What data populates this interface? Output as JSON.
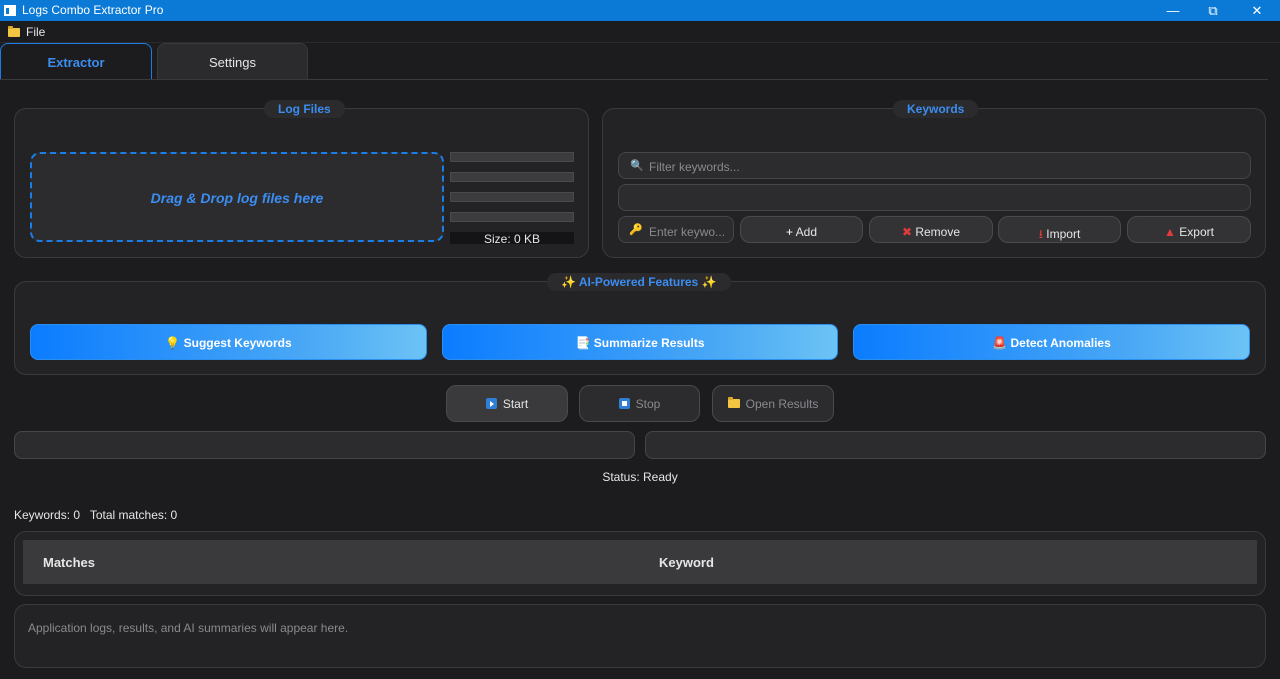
{
  "window": {
    "title": "Logs Combo Extractor Pro"
  },
  "menu": {
    "file": "File"
  },
  "tabs": {
    "extractor": "Extractor",
    "settings": "Settings"
  },
  "log_files": {
    "title": "Log Files",
    "dropzone": "Drag & Drop log files here",
    "size": "Size: 0 KB"
  },
  "keywords_panel": {
    "title": "Keywords",
    "filter_placeholder": "Filter keywords...",
    "enter_placeholder": "Enter keywo...",
    "add": "Add",
    "remove": "Remove",
    "import": "Import",
    "export": "Export"
  },
  "ai": {
    "title": "AI-Powered Features",
    "suggest": "Suggest Keywords",
    "summarize": "Summarize Results",
    "detect": "Detect Anomalies"
  },
  "controls": {
    "start": "Start",
    "stop": "Stop",
    "open_results": "Open Results"
  },
  "status": "Status: Ready",
  "counts": {
    "keywords": "Keywords: 0",
    "matches": "Total matches: 0"
  },
  "table": {
    "columns": [
      "Matches",
      "Keyword"
    ]
  },
  "log": {
    "placeholder": "Application logs, results, and AI summaries will appear here."
  },
  "colors": {
    "accent": "#1a7ee6",
    "titlebar": "#0a7ad6",
    "background": "#1c1c1e"
  }
}
